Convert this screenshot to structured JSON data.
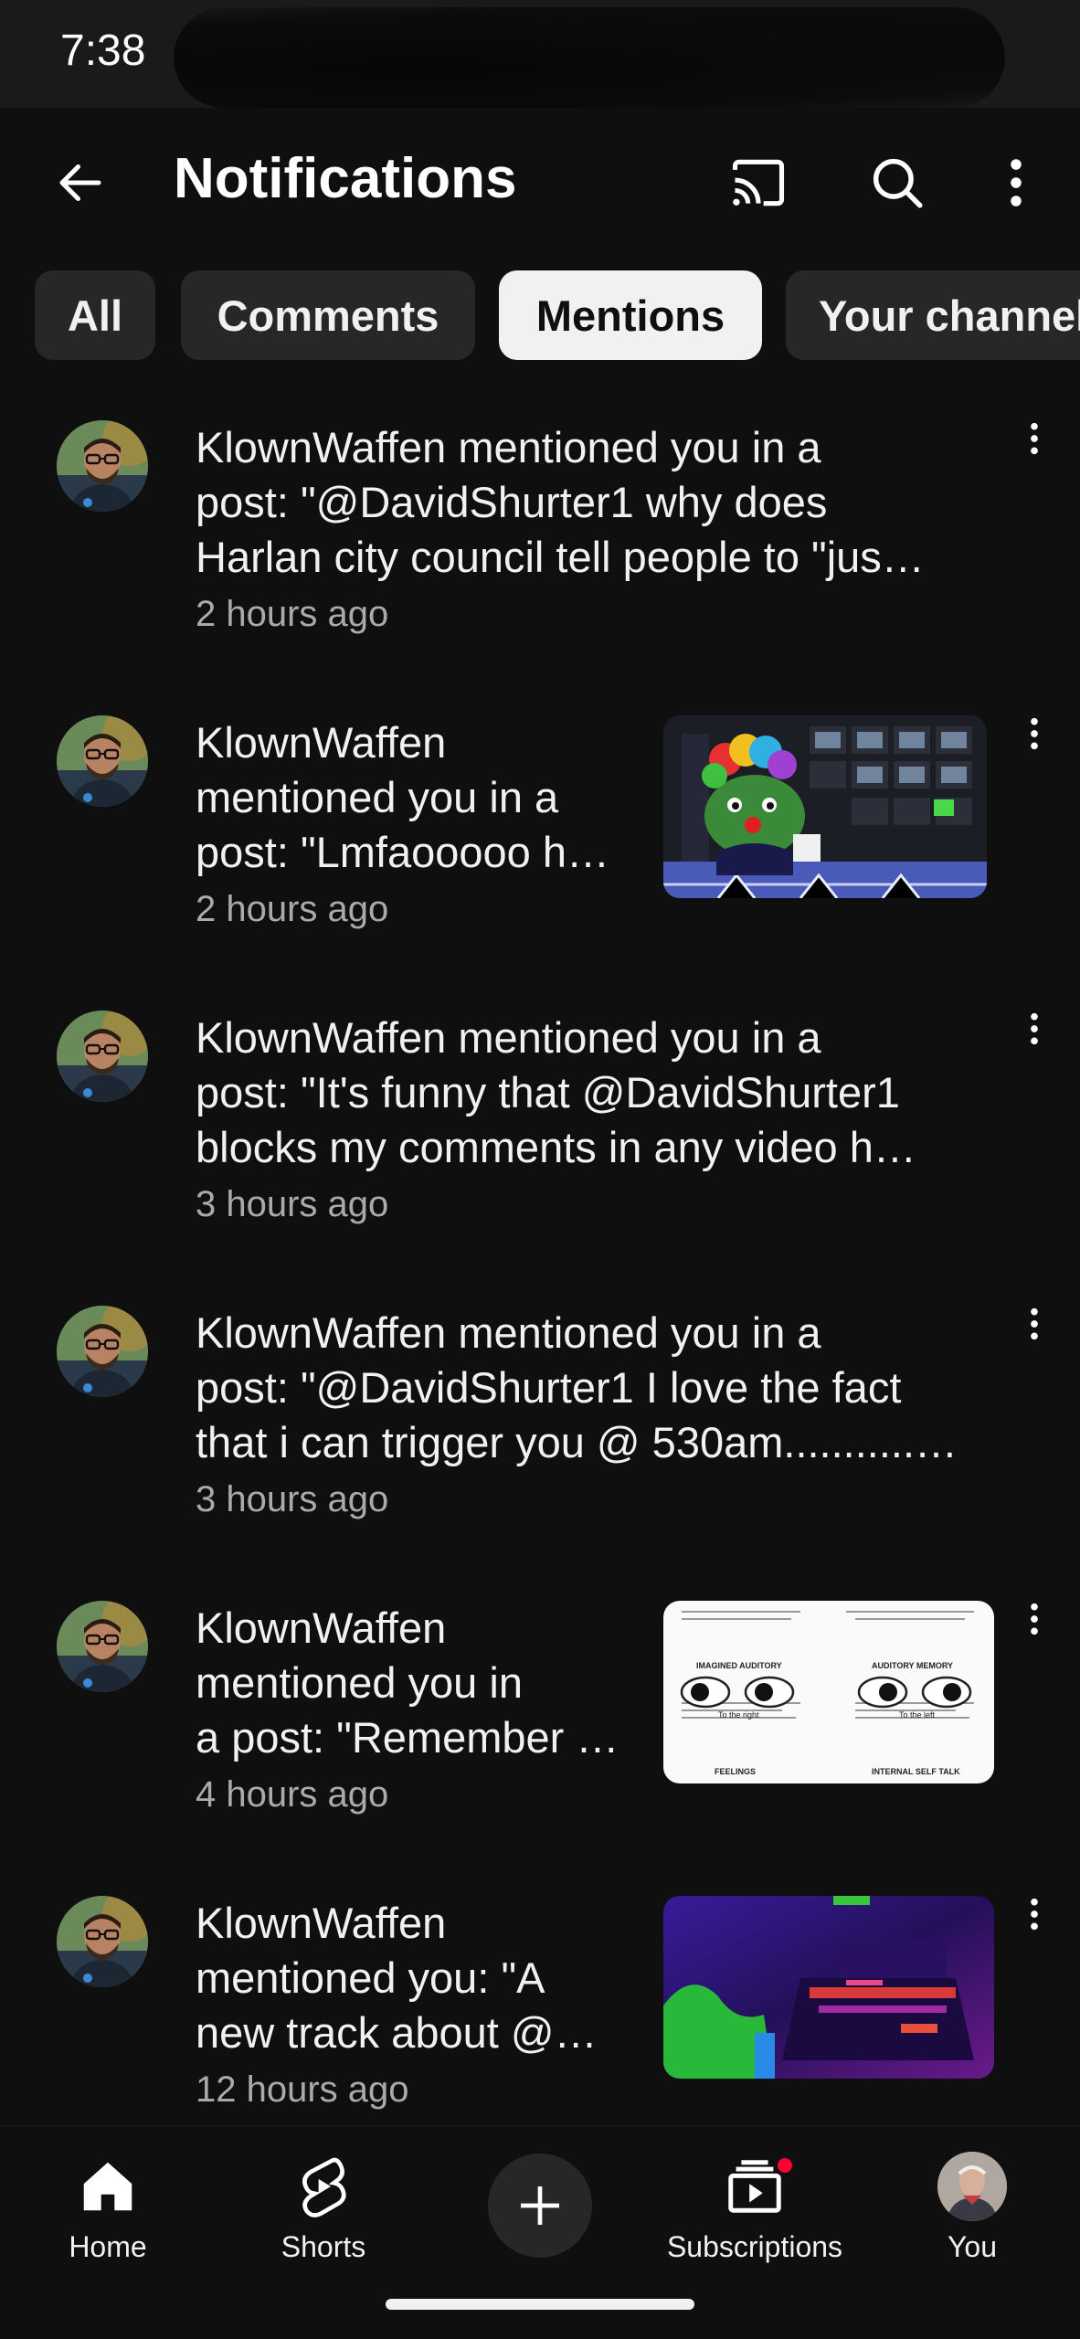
{
  "status_bar": {
    "time": "7:38"
  },
  "app_bar": {
    "title": "Notifications",
    "back_icon": "arrow-left-icon",
    "cast_icon": "cast-icon",
    "search_icon": "search-icon",
    "more_icon": "more-vertical-icon"
  },
  "chips": [
    {
      "label": "All",
      "selected": false
    },
    {
      "label": "Comments",
      "selected": false
    },
    {
      "label": "Mentions",
      "selected": true
    },
    {
      "label": "Your channel",
      "selected": false
    }
  ],
  "notifications": [
    {
      "lines": [
        "KlownWaffen mentioned you in a",
        "post: \"@DavidShurter1 why does",
        "Harlan city council tell people to \"jus…"
      ],
      "time": "2 hours ago"
    },
    {
      "lines": [
        "KlownWaffen",
        "mentioned you in a",
        "post: \"Lmfaooooo h…"
      ],
      "time": "2 hours ago"
    },
    {
      "lines": [
        "KlownWaffen mentioned you in a",
        "post: \"It's funny that @DavidShurter1",
        "blocks my comments in any video h…"
      ],
      "time": "3 hours ago"
    },
    {
      "lines": [
        "KlownWaffen mentioned you in a",
        "post: \"@DavidShurter1  I love the fact",
        "that i can trigger you @ 530am...........…"
      ],
      "time": "3 hours ago"
    },
    {
      "lines": [
        "KlownWaffen",
        "mentioned you in",
        "a post: \"Remember …"
      ],
      "time": "4 hours ago",
      "thumb_labels": [
        "IMAGINED AUDITORY",
        "AUDITORY MEMORY",
        "To the right",
        "To the left",
        "FEELINGS",
        "INTERNAL SELF TALK"
      ]
    },
    {
      "lines": [
        "KlownWaffen",
        "mentioned you: \"A",
        "new track about @…"
      ],
      "time": "12 hours ago"
    }
  ],
  "bottom_nav": {
    "home": "Home",
    "shorts": "Shorts",
    "subscriptions": "Subscriptions",
    "you": "You"
  }
}
